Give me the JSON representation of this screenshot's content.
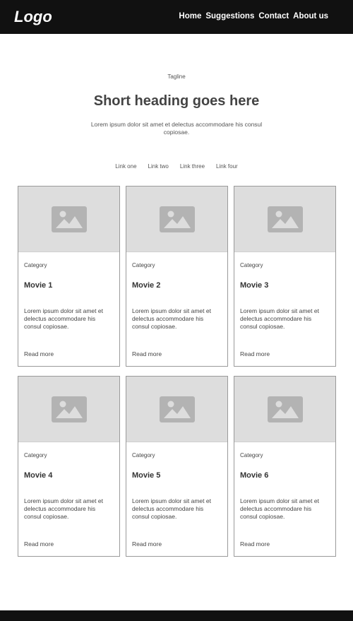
{
  "header": {
    "logo": "Logo",
    "nav": [
      "Home",
      "Suggestions",
      "Contact",
      "About us"
    ]
  },
  "hero": {
    "tagline": "Tagline",
    "heading": "Short heading goes here",
    "intro": "Lorem ipsum dolor sit amet et delectus accommodare his consul copiosae."
  },
  "links": [
    "Link one",
    "Link two",
    "Link three",
    "Link four"
  ],
  "cards": [
    {
      "category": "Category",
      "title": "Movie 1",
      "description": "Lorem ipsum dolor sit amet et delectus accommodare his consul copiosae.",
      "link": "Read more"
    },
    {
      "category": "Category",
      "title": "Movie 2",
      "description": "Lorem ipsum dolor sit amet et delectus accommodare his consul copiosae.",
      "link": "Read more"
    },
    {
      "category": "Category",
      "title": "Movie 3",
      "description": "Lorem ipsum dolor sit amet et delectus accommodare his consul copiosae.",
      "link": "Read more"
    },
    {
      "category": "Category",
      "title": "Movie 4",
      "description": "Lorem ipsum dolor sit amet et delectus accommodare his consul copiosae.",
      "link": "Read more"
    },
    {
      "category": "Category",
      "title": "Movie 5",
      "description": "Lorem ipsum dolor sit amet et delectus accommodare his consul copiosae.",
      "link": "Read more"
    },
    {
      "category": "Category",
      "title": "Movie 6",
      "description": "Lorem ipsum dolor sit amet et delectus accommodare his consul copiosae.",
      "link": "Read more"
    }
  ],
  "icons": {
    "card_image": "image-placeholder-icon"
  },
  "colors": {
    "header_bg": "#111111",
    "image_bg": "#dddddd",
    "icon": "#b3b3b3"
  }
}
